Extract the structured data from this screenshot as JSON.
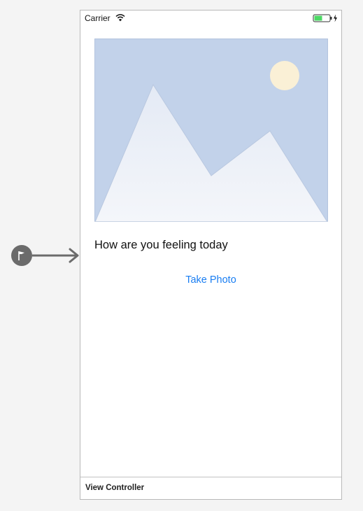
{
  "status_bar": {
    "carrier": "Carrier",
    "wifi_icon": "wifi-icon",
    "battery_icon": "battery-charging-icon",
    "battery_color": "#4cd964"
  },
  "image_view": {
    "icon": "image-placeholder-icon",
    "sky_color": "#c2d2ea",
    "sun_color": "#faf0d6"
  },
  "content": {
    "question_label": "How are you feeling today",
    "take_photo_button": "Take Photo",
    "accent_color": "#1a7ef2"
  },
  "scene": {
    "title": "View Controller"
  },
  "entry_point": {
    "icon": "storyboard-entry-point-icon"
  }
}
